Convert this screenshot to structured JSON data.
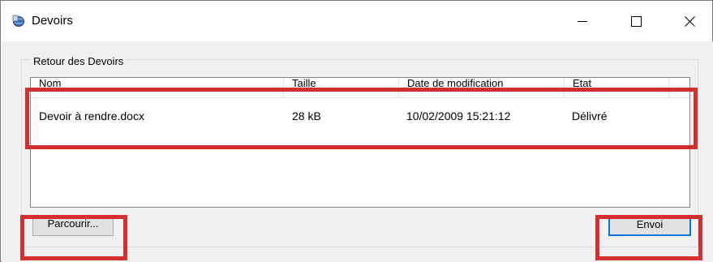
{
  "window": {
    "title": "Devoirs",
    "icon": "globe-app-icon",
    "controls": {
      "minimize": "minimize-icon",
      "maximize": "maximize-icon",
      "close": "close-icon"
    }
  },
  "group": {
    "label": "Retour des Devoirs"
  },
  "list": {
    "columns": [
      "Nom",
      "Taille",
      "Date de modification",
      "Etat"
    ],
    "rows": [
      {
        "name": "Devoir à rendre.docx",
        "size": "28 kB",
        "modified": "10/02/2009 15:21:12",
        "status": "Délivré"
      }
    ]
  },
  "buttons": {
    "browse": "Parcourir...",
    "send": "Envoi"
  },
  "colors": {
    "highlight": "#d32f2f",
    "accent": "#0078d7",
    "client_bg": "#f0f0f0"
  }
}
